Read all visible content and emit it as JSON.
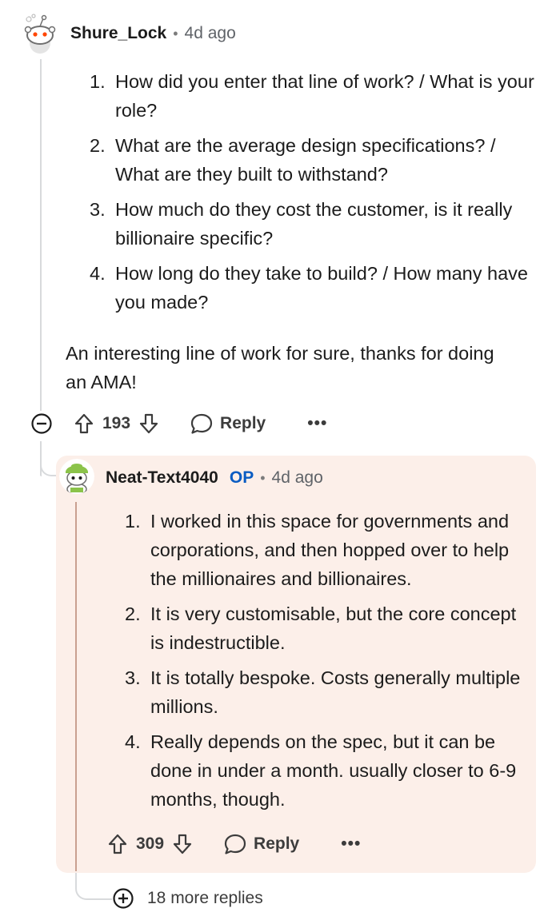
{
  "comment": {
    "author": "Shure_Lock",
    "time": "4d ago",
    "items": [
      {
        "num": "1.",
        "text": "How did you enter that line of work? / What is your role?"
      },
      {
        "num": "2.",
        "text": "What are the average design specifications? / What are they built to withstand?"
      },
      {
        "num": "3.",
        "text": "How much do they cost the customer, is it really billionaire specific?"
      },
      {
        "num": "4.",
        "text": "How long do they take to build? / How many have you made?"
      }
    ],
    "closing": "An interesting line of work for sure, thanks for doing an AMA!",
    "votes": "193",
    "reply_label": "Reply",
    "more_label": "•••"
  },
  "reply": {
    "author": "Neat-Text4040",
    "op_badge": "OP",
    "time": "4d ago",
    "items": [
      {
        "num": "1.",
        "text": "I worked in this space for governments and corporations, and then hopped over to help the millionaires and billionaires."
      },
      {
        "num": "2.",
        "text": "It is very customisable, but the core concept is indestructible."
      },
      {
        "num": "3.",
        "text": "It is totally bespoke. Costs generally multiple millions."
      },
      {
        "num": "4.",
        "text": "Really depends on the spec, but it can be done in under a month. usually closer to 6-9 months, though."
      }
    ],
    "votes": "309",
    "reply_label": "Reply",
    "more_label": "•••"
  },
  "more_replies_label": "18 more replies",
  "colors": {
    "op": "#0a5cc2",
    "reply_bg": "#fcefe9",
    "thread_line": "#d8dadc",
    "op_line": "#c9a090"
  }
}
